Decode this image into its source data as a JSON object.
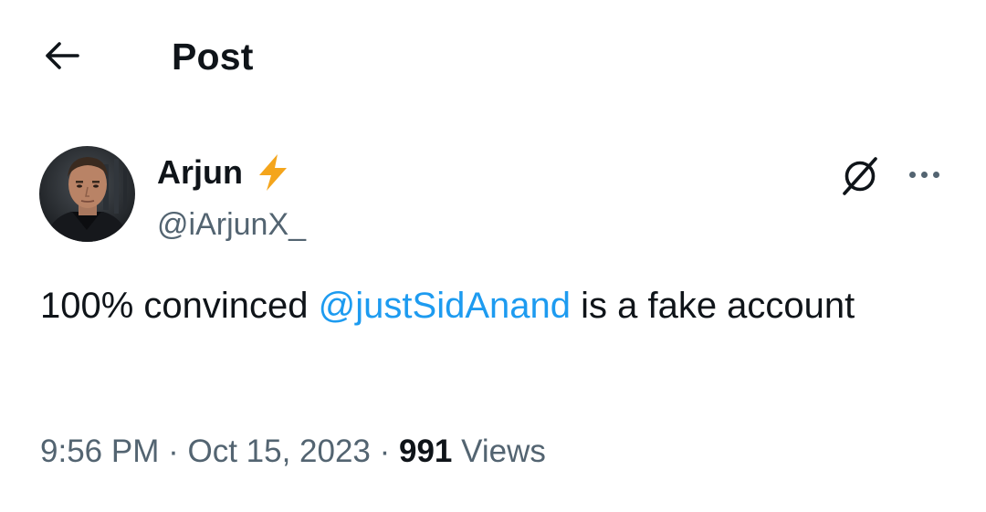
{
  "header": {
    "title": "Post",
    "back_icon": "arrow-left-icon"
  },
  "author": {
    "name": "Arjun",
    "handle": "@iArjunX_",
    "badge_icon": "lightning-bolt-icon",
    "badge_color": "#f4a51c"
  },
  "actions": {
    "grok_icon": "grok-icon",
    "more_icon": "more-horizontal-icon"
  },
  "post": {
    "text_before": "100% convinced ",
    "mention": "@justSidAnand",
    "text_after": " is a fake account"
  },
  "meta": {
    "time": "9:56 PM",
    "separator": " · ",
    "date": "Oct 15, 2023",
    "views_count": "991",
    "views_label": " Views"
  },
  "colors": {
    "text_primary": "#0f1419",
    "text_secondary": "#536471",
    "link": "#1d9bf0"
  }
}
